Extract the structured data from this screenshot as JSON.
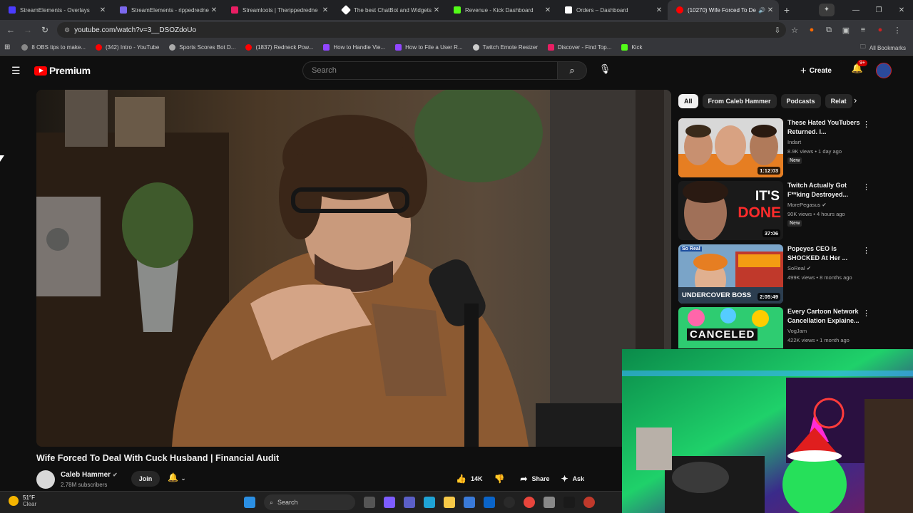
{
  "browser": {
    "tabs": [
      {
        "title": "StreamElements - Overlays",
        "color": "#4b3cff"
      },
      {
        "title": "StreamElements - rippedredne",
        "color": "#7b68ee"
      },
      {
        "title": "Streamloots | Therippedredne",
        "color": "#e91e63"
      },
      {
        "title": "The best ChatBot and Widgets",
        "color": "#ffffff"
      },
      {
        "title": "Revenue - Kick Dashboard",
        "color": "#53fc18"
      },
      {
        "title": "Orders – Dashboard",
        "color": "#ffffff"
      },
      {
        "title": "(10270) Wife Forced To De",
        "color": "#ff0000"
      }
    ],
    "url": "youtube.com/watch?v=3__DSOZdoUo",
    "bookmarks": [
      {
        "label": "8 OBS tips to make...",
        "color": "#888888"
      },
      {
        "label": "(342) Intro - YouTube",
        "color": "#ff0000"
      },
      {
        "label": "Sports Scores Bot D...",
        "color": "#aaaaaa"
      },
      {
        "label": "(1837) Redneck Pow...",
        "color": "#ff0000"
      },
      {
        "label": "How to Handle Vie...",
        "color": "#9146ff"
      },
      {
        "label": "How to File a User R...",
        "color": "#9146ff"
      },
      {
        "label": "Twitch Emote Resizer",
        "color": "#cccccc"
      },
      {
        "label": "Discover - Find Top...",
        "color": "#e91e63"
      },
      {
        "label": "Kick",
        "color": "#53fc18"
      }
    ],
    "all_bookmarks": "All Bookmarks"
  },
  "youtube": {
    "logo_text": "Premium",
    "search_placeholder": "Search",
    "create_label": "Create",
    "notif_badge": "9+",
    "video_title": "Wife Forced To Deal With Cuck Husband | Financial Audit",
    "channel_name": "Caleb Hammer",
    "subscribers": "2.78M subscribers",
    "join_label": "Join",
    "like_count": "14K",
    "share_label": "Share",
    "ask_label": "Ask",
    "chips": [
      "All",
      "From Caleb Hammer",
      "Podcasts",
      "Relat"
    ],
    "recommendations": [
      {
        "title": "These Hated YouTubers Returned. I...",
        "channel": "Indart",
        "meta": "8.9K views • 1 day ago",
        "badge": "New",
        "duration": "1:12:03"
      },
      {
        "title": "Twitch Actually Got F**king Destroyed...",
        "channel": "MorePegasus",
        "meta": "90K views • 4 hours ago",
        "badge": "New",
        "duration": "37:06",
        "thumb_text": "IT'S DONE"
      },
      {
        "title": "Popeyes CEO Is SHOCKED At Her ...",
        "channel": "SoReal",
        "meta": "499K views • 8 months ago",
        "badge": "",
        "duration": "2:05:49",
        "thumb_text": "UNDERCOVER BOSS",
        "thumb_tag": "So Real"
      },
      {
        "title": "Every Cartoon Network Cancellation Explaine...",
        "channel": "VogJam",
        "meta": "422K views • 1 month ago",
        "badge": "",
        "duration": "",
        "thumb_text": "CANCELED"
      }
    ]
  },
  "taskbar": {
    "temp": "51°F",
    "condition": "Clear",
    "search": "Search"
  }
}
